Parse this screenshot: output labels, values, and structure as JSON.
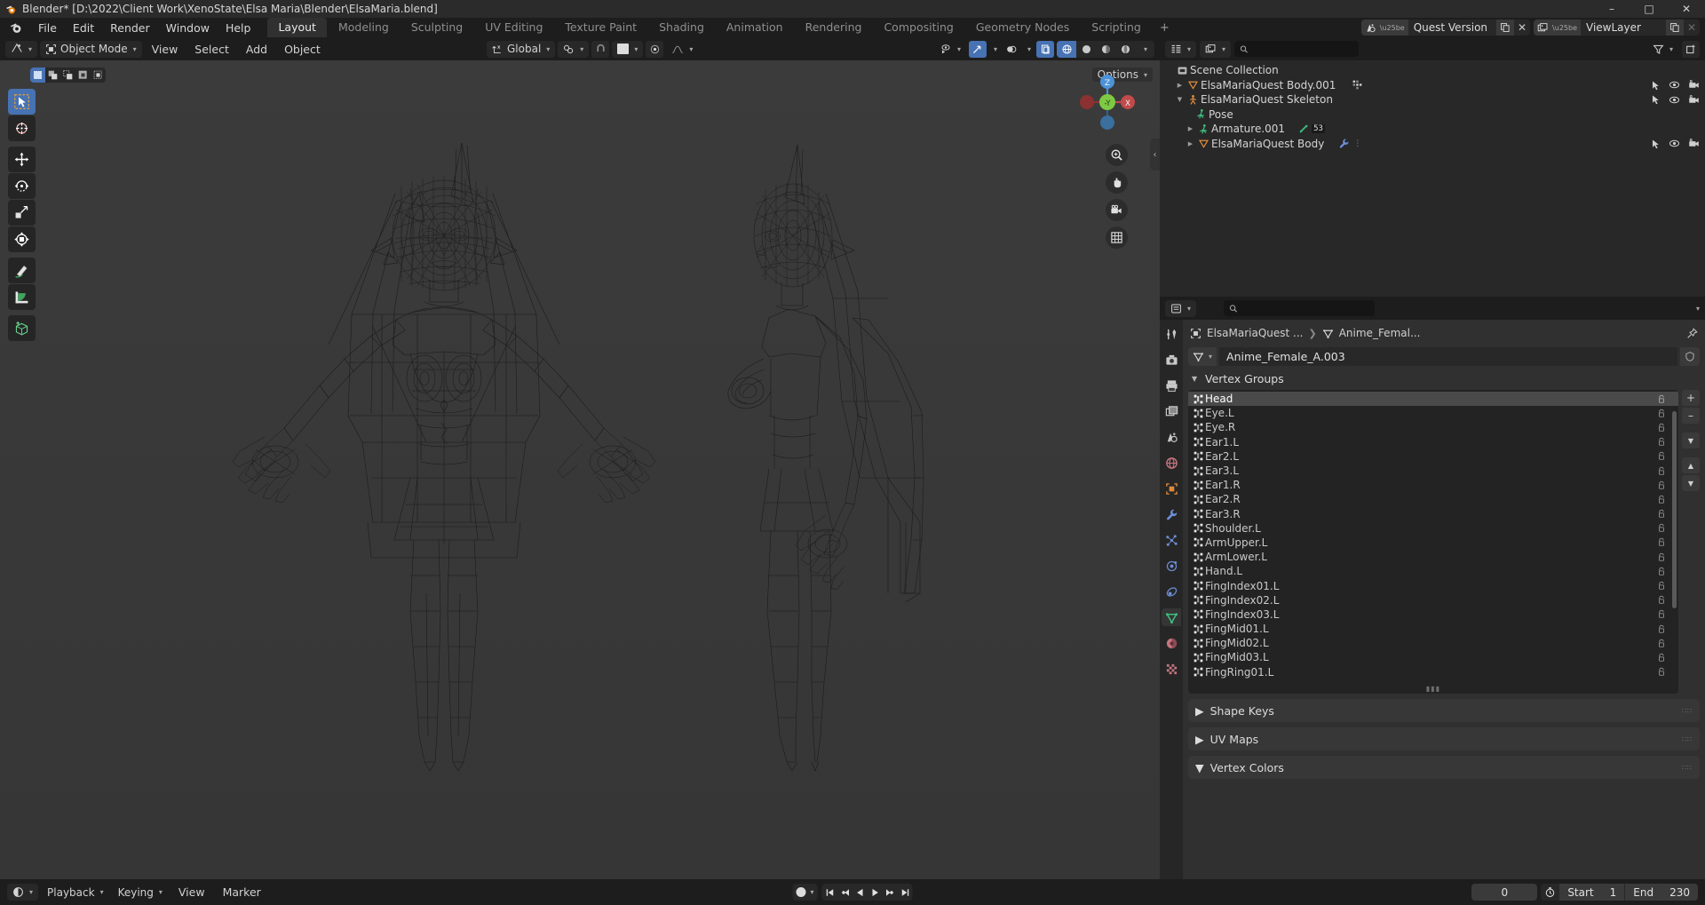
{
  "titlebar": {
    "title": "Blender* [D:\\2022\\Client Work\\XenoState\\Elsa Maria\\Blender\\ElsaMaria.blend]",
    "minimize": "–",
    "maximize": "□",
    "close": "✕"
  },
  "topbar": {
    "menus": [
      "File",
      "Edit",
      "Render",
      "Window",
      "Help"
    ],
    "workspaces": [
      {
        "label": "Layout",
        "active": true
      },
      {
        "label": "Modeling",
        "active": false
      },
      {
        "label": "Sculpting",
        "active": false
      },
      {
        "label": "UV Editing",
        "active": false
      },
      {
        "label": "Texture Paint",
        "active": false
      },
      {
        "label": "Shading",
        "active": false
      },
      {
        "label": "Animation",
        "active": false
      },
      {
        "label": "Rendering",
        "active": false
      },
      {
        "label": "Compositing",
        "active": false
      },
      {
        "label": "Geometry Nodes",
        "active": false
      },
      {
        "label": "Scripting",
        "active": false
      }
    ],
    "add_workspace": "+",
    "scene": {
      "name": "Quest Version",
      "copy": "❐",
      "remove": "✕"
    },
    "view_layer": {
      "name": "ViewLayer",
      "copy": "❐",
      "remove": "✕"
    }
  },
  "viewport": {
    "mode": "Object Mode",
    "menus": [
      "View",
      "Select",
      "Add",
      "Object"
    ],
    "transform_orientation": "Global",
    "options_label": "Options",
    "gizmo_axes": {
      "z": "Z",
      "y": "-Y",
      "x": "X"
    },
    "tools": [
      {
        "name": "select-box-tool",
        "active": true
      },
      {
        "name": "cursor-tool",
        "active": false
      },
      {
        "name": "move-tool",
        "active": false
      },
      {
        "name": "rotate-tool",
        "active": false
      },
      {
        "name": "scale-tool",
        "active": false
      },
      {
        "name": "transform-tool",
        "active": false
      },
      {
        "name": "annotate-tool",
        "active": false
      },
      {
        "name": "measure-tool",
        "active": false
      },
      {
        "name": "add-cube-tool",
        "active": false
      }
    ],
    "shading_modes": [
      "wireframe",
      "solid",
      "material-preview",
      "rendered"
    ],
    "active_shading": "wireframe"
  },
  "outliner": {
    "search_placeholder": "",
    "rows": [
      {
        "label": "Scene Collection",
        "indent": 0,
        "icon": "collection-icon",
        "tri": "",
        "controls": false
      },
      {
        "label": "ElsaMariaQuest Body.001",
        "indent": 1,
        "icon": "mesh-object-icon",
        "tri": "▶",
        "controls": true,
        "badge": "modifier-grid"
      },
      {
        "label": "ElsaMariaQuest Skeleton",
        "indent": 1,
        "icon": "armature-icon",
        "tri": "▼",
        "controls": true
      },
      {
        "label": "Pose",
        "indent": 2,
        "icon": "pose-icon",
        "tri": "",
        "controls": false
      },
      {
        "label": "Armature.001",
        "indent": 2,
        "icon": "armature-data-icon",
        "tri": "▶",
        "controls": false,
        "count": "53"
      },
      {
        "label": "ElsaMariaQuest Body",
        "indent": 2,
        "icon": "mesh-object-icon",
        "tri": "▶",
        "controls": true,
        "wrench": true
      }
    ]
  },
  "properties": {
    "search_placeholder": "",
    "breadcrumb": [
      "ElsaMariaQuest ...",
      "Anime_Femal..."
    ],
    "datablock_name": "Anime_Female_A.003",
    "tabs": [
      {
        "name": "tool-tab",
        "active": false
      },
      {
        "name": "render-tab",
        "active": false
      },
      {
        "name": "output-tab",
        "active": false
      },
      {
        "name": "view-layer-tab",
        "active": false
      },
      {
        "name": "scene-tab",
        "active": false
      },
      {
        "name": "world-tab",
        "active": false
      },
      {
        "name": "object-tab",
        "active": false
      },
      {
        "name": "modifier-tab",
        "active": false
      },
      {
        "name": "particles-tab",
        "active": false
      },
      {
        "name": "physics-tab",
        "active": false
      },
      {
        "name": "constraints-tab",
        "active": false
      },
      {
        "name": "object-data-tab",
        "active": true
      },
      {
        "name": "material-tab",
        "active": false
      },
      {
        "name": "texture-tab",
        "active": false
      }
    ],
    "vertex_groups_label": "Vertex Groups",
    "vertex_groups": [
      {
        "name": "Head",
        "selected": true
      },
      {
        "name": "Eye.L",
        "selected": false
      },
      {
        "name": "Eye.R",
        "selected": false
      },
      {
        "name": "Ear1.L",
        "selected": false
      },
      {
        "name": "Ear2.L",
        "selected": false
      },
      {
        "name": "Ear3.L",
        "selected": false
      },
      {
        "name": "Ear1.R",
        "selected": false
      },
      {
        "name": "Ear2.R",
        "selected": false
      },
      {
        "name": "Ear3.R",
        "selected": false
      },
      {
        "name": "Shoulder.L",
        "selected": false
      },
      {
        "name": "ArmUpper.L",
        "selected": false
      },
      {
        "name": "ArmLower.L",
        "selected": false
      },
      {
        "name": "Hand.L",
        "selected": false
      },
      {
        "name": "FingIndex01.L",
        "selected": false
      },
      {
        "name": "FingIndex02.L",
        "selected": false
      },
      {
        "name": "FingIndex03.L",
        "selected": false
      },
      {
        "name": "FingMid01.L",
        "selected": false
      },
      {
        "name": "FingMid02.L",
        "selected": false
      },
      {
        "name": "FingMid03.L",
        "selected": false
      },
      {
        "name": "FingRing01.L",
        "selected": false
      }
    ],
    "vg_buttons": {
      "add": "+",
      "remove": "–",
      "menu": "∨",
      "up": "▲",
      "down": "▼"
    },
    "sub_panels": [
      {
        "label": "Shape Keys",
        "open": false
      },
      {
        "label": "UV Maps",
        "open": false
      },
      {
        "label": "Vertex Colors",
        "open": true
      }
    ]
  },
  "timeline": {
    "menus": [
      "Playback",
      "Keying",
      "View",
      "Marker"
    ],
    "current_frame": "0",
    "start_label": "Start",
    "start_value": "1",
    "end_label": "End",
    "end_value": "230"
  },
  "colors": {
    "accent_blue": "#4772b3",
    "orange": "#e08a3c",
    "green": "#5ac35a",
    "viewport_bg": "#3a3a3a"
  }
}
